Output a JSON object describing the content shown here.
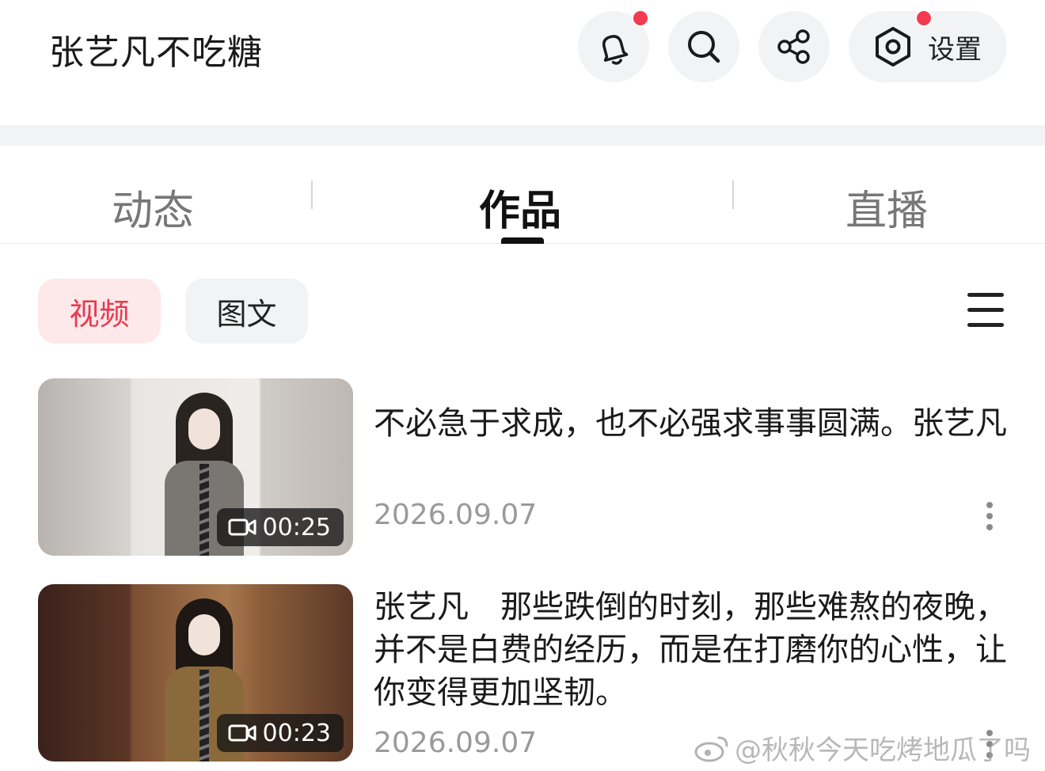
{
  "header": {
    "username": "张艺凡不吃糖",
    "settings_label": "设置"
  },
  "tabs": [
    {
      "label": "动态"
    },
    {
      "label": "作品"
    },
    {
      "label": "直播"
    }
  ],
  "filters": {
    "video": "视频",
    "image_text": "图文"
  },
  "items": [
    {
      "title": "不必急于求成，也不必强求事事圆满。张艺凡",
      "date": "2026.09.07",
      "duration": "00:25"
    },
    {
      "title": "张艺凡　那些跌倒的时刻，那些难熬的夜晚，并不是白费的经历，而是在打磨你的心性，让你变得更加坚韧。",
      "date": "2026.09.07",
      "duration": "00:23"
    }
  ],
  "watermark": "@秋秋今天吃烤地瓜了吗",
  "colors": {
    "accent": "#e8384c",
    "badge_dot": "#f23b50",
    "chip_bg_active": "#fde8ea",
    "chip_bg": "#f2f3f5"
  }
}
